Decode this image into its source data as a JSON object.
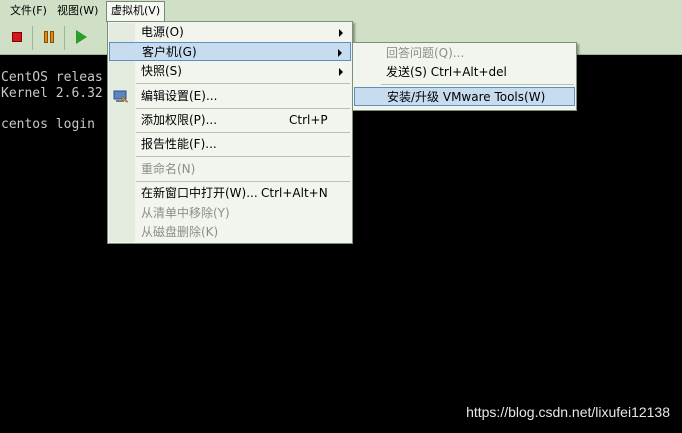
{
  "menubar": {
    "file": "文件(F)",
    "view": "视图(W)",
    "vm": "虚拟机(V)"
  },
  "console": {
    "line1": "CentOS releas",
    "line2": "Kernel 2.6.32",
    "line3": "centos login"
  },
  "vm_menu": {
    "power": "电源(O)",
    "guest": "客户机(G)",
    "snapshot": "快照(S)",
    "edit_settings": "编辑设置(E)...",
    "add_permission": "添加权限(P)...",
    "add_permission_shortcut": "Ctrl+P",
    "report_performance": "报告性能(F)...",
    "rename": "重命名(N)",
    "open_new_window": "在新窗口中打开(W)...",
    "open_new_window_shortcut": "Ctrl+Alt+N",
    "remove_from_list": "从清单中移除(Y)",
    "delete_from_disk": "从磁盘删除(K)"
  },
  "guest_submenu": {
    "answer_question": "回答问题(Q)...",
    "send_cad": "发送(S) Ctrl+Alt+del",
    "install_tools": "安装/升级 VMware Tools(W)"
  },
  "watermark": "https://blog.csdn.net/lixufei12138"
}
